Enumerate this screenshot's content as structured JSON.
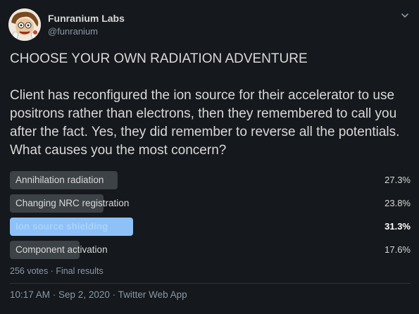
{
  "author": {
    "display_name": "Funranium Labs",
    "handle": "@funranium",
    "avatar_icon": "cartoon-scientist-avatar"
  },
  "menu": {
    "icon": "chevron-down-icon"
  },
  "tweet": {
    "headline": "CHOOSE YOUR OWN RADIATION ADVENTURE",
    "body": "Client has reconfigured the ion source for their accelerator to use positrons rather than electrons, then they remembered to call you after the fact. Yes, they did remember to reverse all the potentials. What causes you the most concern?"
  },
  "poll": {
    "choices": [
      {
        "label": "Annihilation radiation",
        "percent_text": "27.3%",
        "percent": 27.3,
        "winner": false
      },
      {
        "label": "Changing NRC registration",
        "percent_text": "23.8%",
        "percent": 23.8,
        "winner": false
      },
      {
        "label": "Ion source shielding",
        "percent_text": "31.3%",
        "percent": 31.3,
        "winner": true
      },
      {
        "label": "Component activation",
        "percent_text": "17.6%",
        "percent": 17.6,
        "winner": false
      }
    ],
    "summary": "256 votes · Final results"
  },
  "footer": {
    "timestamp": "10:17 AM · Sep 2, 2020 · Twitter Web App"
  },
  "colors": {
    "background": "#15181c",
    "bar": "#3d4247",
    "winner_bar": "#8dc1f8",
    "text": "#d9d9d9",
    "muted": "#8b98a5"
  }
}
